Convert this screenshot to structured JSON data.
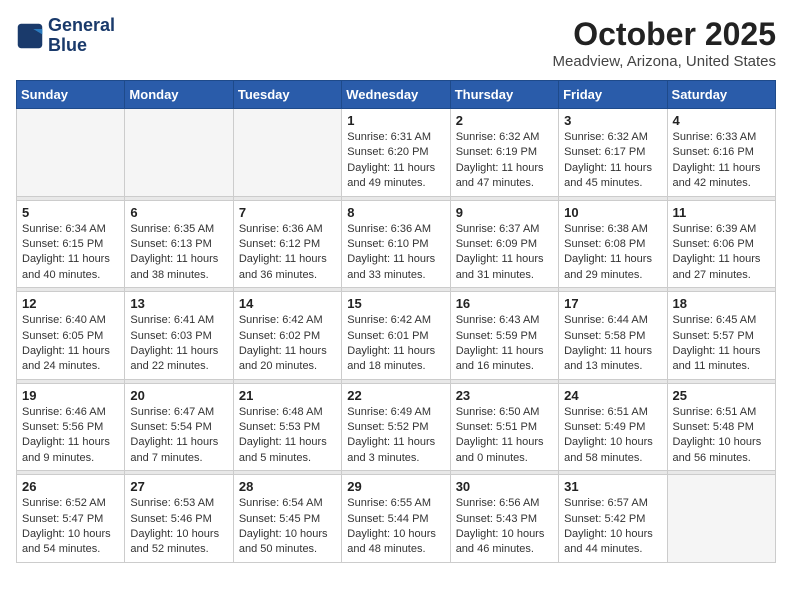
{
  "logo": {
    "line1": "General",
    "line2": "Blue"
  },
  "title": "October 2025",
  "location": "Meadview, Arizona, United States",
  "days_of_week": [
    "Sunday",
    "Monday",
    "Tuesday",
    "Wednesday",
    "Thursday",
    "Friday",
    "Saturday"
  ],
  "weeks": [
    [
      {
        "day": "",
        "info": ""
      },
      {
        "day": "",
        "info": ""
      },
      {
        "day": "",
        "info": ""
      },
      {
        "day": "1",
        "info": "Sunrise: 6:31 AM\nSunset: 6:20 PM\nDaylight: 11 hours and 49 minutes."
      },
      {
        "day": "2",
        "info": "Sunrise: 6:32 AM\nSunset: 6:19 PM\nDaylight: 11 hours and 47 minutes."
      },
      {
        "day": "3",
        "info": "Sunrise: 6:32 AM\nSunset: 6:17 PM\nDaylight: 11 hours and 45 minutes."
      },
      {
        "day": "4",
        "info": "Sunrise: 6:33 AM\nSunset: 6:16 PM\nDaylight: 11 hours and 42 minutes."
      }
    ],
    [
      {
        "day": "5",
        "info": "Sunrise: 6:34 AM\nSunset: 6:15 PM\nDaylight: 11 hours and 40 minutes."
      },
      {
        "day": "6",
        "info": "Sunrise: 6:35 AM\nSunset: 6:13 PM\nDaylight: 11 hours and 38 minutes."
      },
      {
        "day": "7",
        "info": "Sunrise: 6:36 AM\nSunset: 6:12 PM\nDaylight: 11 hours and 36 minutes."
      },
      {
        "day": "8",
        "info": "Sunrise: 6:36 AM\nSunset: 6:10 PM\nDaylight: 11 hours and 33 minutes."
      },
      {
        "day": "9",
        "info": "Sunrise: 6:37 AM\nSunset: 6:09 PM\nDaylight: 11 hours and 31 minutes."
      },
      {
        "day": "10",
        "info": "Sunrise: 6:38 AM\nSunset: 6:08 PM\nDaylight: 11 hours and 29 minutes."
      },
      {
        "day": "11",
        "info": "Sunrise: 6:39 AM\nSunset: 6:06 PM\nDaylight: 11 hours and 27 minutes."
      }
    ],
    [
      {
        "day": "12",
        "info": "Sunrise: 6:40 AM\nSunset: 6:05 PM\nDaylight: 11 hours and 24 minutes."
      },
      {
        "day": "13",
        "info": "Sunrise: 6:41 AM\nSunset: 6:03 PM\nDaylight: 11 hours and 22 minutes."
      },
      {
        "day": "14",
        "info": "Sunrise: 6:42 AM\nSunset: 6:02 PM\nDaylight: 11 hours and 20 minutes."
      },
      {
        "day": "15",
        "info": "Sunrise: 6:42 AM\nSunset: 6:01 PM\nDaylight: 11 hours and 18 minutes."
      },
      {
        "day": "16",
        "info": "Sunrise: 6:43 AM\nSunset: 5:59 PM\nDaylight: 11 hours and 16 minutes."
      },
      {
        "day": "17",
        "info": "Sunrise: 6:44 AM\nSunset: 5:58 PM\nDaylight: 11 hours and 13 minutes."
      },
      {
        "day": "18",
        "info": "Sunrise: 6:45 AM\nSunset: 5:57 PM\nDaylight: 11 hours and 11 minutes."
      }
    ],
    [
      {
        "day": "19",
        "info": "Sunrise: 6:46 AM\nSunset: 5:56 PM\nDaylight: 11 hours and 9 minutes."
      },
      {
        "day": "20",
        "info": "Sunrise: 6:47 AM\nSunset: 5:54 PM\nDaylight: 11 hours and 7 minutes."
      },
      {
        "day": "21",
        "info": "Sunrise: 6:48 AM\nSunset: 5:53 PM\nDaylight: 11 hours and 5 minutes."
      },
      {
        "day": "22",
        "info": "Sunrise: 6:49 AM\nSunset: 5:52 PM\nDaylight: 11 hours and 3 minutes."
      },
      {
        "day": "23",
        "info": "Sunrise: 6:50 AM\nSunset: 5:51 PM\nDaylight: 11 hours and 0 minutes."
      },
      {
        "day": "24",
        "info": "Sunrise: 6:51 AM\nSunset: 5:49 PM\nDaylight: 10 hours and 58 minutes."
      },
      {
        "day": "25",
        "info": "Sunrise: 6:51 AM\nSunset: 5:48 PM\nDaylight: 10 hours and 56 minutes."
      }
    ],
    [
      {
        "day": "26",
        "info": "Sunrise: 6:52 AM\nSunset: 5:47 PM\nDaylight: 10 hours and 54 minutes."
      },
      {
        "day": "27",
        "info": "Sunrise: 6:53 AM\nSunset: 5:46 PM\nDaylight: 10 hours and 52 minutes."
      },
      {
        "day": "28",
        "info": "Sunrise: 6:54 AM\nSunset: 5:45 PM\nDaylight: 10 hours and 50 minutes."
      },
      {
        "day": "29",
        "info": "Sunrise: 6:55 AM\nSunset: 5:44 PM\nDaylight: 10 hours and 48 minutes."
      },
      {
        "day": "30",
        "info": "Sunrise: 6:56 AM\nSunset: 5:43 PM\nDaylight: 10 hours and 46 minutes."
      },
      {
        "day": "31",
        "info": "Sunrise: 6:57 AM\nSunset: 5:42 PM\nDaylight: 10 hours and 44 minutes."
      },
      {
        "day": "",
        "info": ""
      }
    ]
  ]
}
